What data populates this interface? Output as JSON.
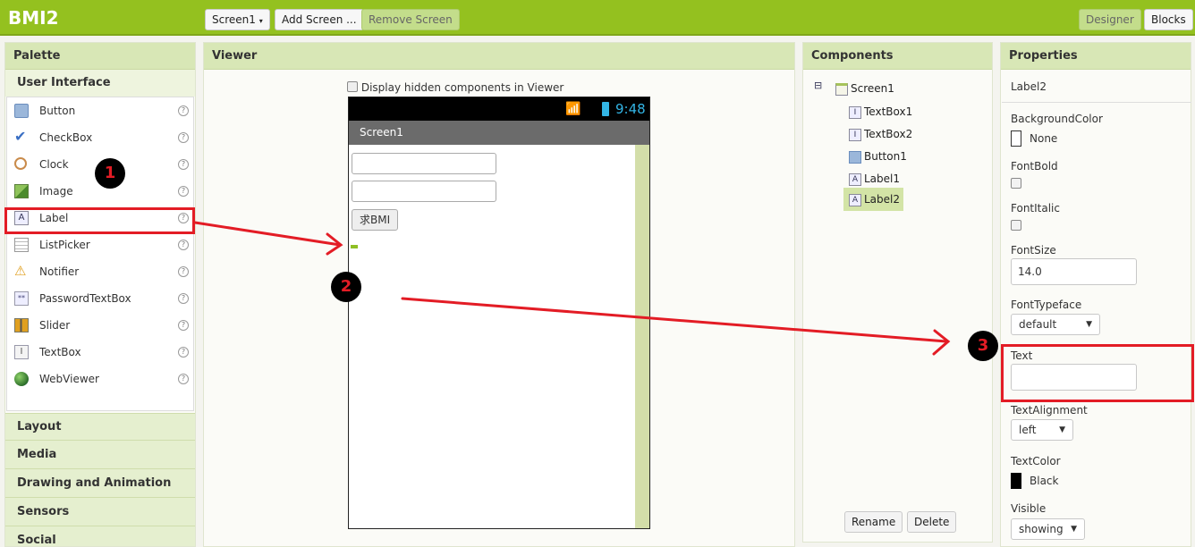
{
  "app": {
    "title": "BMI2"
  },
  "toolbar": {
    "screen_select": "Screen1",
    "add_screen": "Add Screen ...",
    "remove_screen": "Remove Screen",
    "designer": "Designer",
    "blocks": "Blocks"
  },
  "palette": {
    "header": "Palette",
    "category_open": "User Interface",
    "items": [
      {
        "label": "Button",
        "icon": "button-icon"
      },
      {
        "label": "CheckBox",
        "icon": "checkbox-icon"
      },
      {
        "label": "Clock",
        "icon": "clock-icon"
      },
      {
        "label": "Image",
        "icon": "image-icon"
      },
      {
        "label": "Label",
        "icon": "label-icon"
      },
      {
        "label": "ListPicker",
        "icon": "listpicker-icon"
      },
      {
        "label": "Notifier",
        "icon": "notifier-icon"
      },
      {
        "label": "PasswordTextBox",
        "icon": "passwordtextbox-icon"
      },
      {
        "label": "Slider",
        "icon": "slider-icon"
      },
      {
        "label": "TextBox",
        "icon": "textbox-icon"
      },
      {
        "label": "WebViewer",
        "icon": "webviewer-icon"
      }
    ],
    "help_glyph": "?",
    "categories": [
      "Layout",
      "Media",
      "Drawing and Animation",
      "Sensors",
      "Social"
    ]
  },
  "viewer": {
    "header": "Viewer",
    "hidden_checkbox_label": "Display hidden components in Viewer",
    "phone_time": "9:48",
    "screen_title": "Screen1",
    "button_label": "求BMI"
  },
  "components": {
    "header": "Components",
    "collapse_glyph": "⊟",
    "root": "Screen1",
    "children": [
      "TextBox1",
      "TextBox2",
      "Button1",
      "Label1",
      "Label2"
    ],
    "rename": "Rename",
    "delete": "Delete"
  },
  "properties": {
    "header": "Properties",
    "component_name": "Label2",
    "background_color_label": "BackgroundColor",
    "background_color_value": "None",
    "font_bold_label": "FontBold",
    "font_italic_label": "FontItalic",
    "font_size_label": "FontSize",
    "font_size_value": "14.0",
    "font_typeface_label": "FontTypeface",
    "font_typeface_value": "default",
    "text_label": "Text",
    "text_value": "",
    "text_alignment_label": "TextAlignment",
    "text_alignment_value": "left",
    "text_color_label": "TextColor",
    "text_color_value": "Black",
    "visible_label": "Visible",
    "visible_value": "showing"
  },
  "annotations": {
    "step1": "1",
    "step2": "2",
    "step3": "3"
  },
  "colors": {
    "topbar": "#94c11f",
    "header": "#d8e7b6",
    "annotation_red": "#e31c25"
  }
}
